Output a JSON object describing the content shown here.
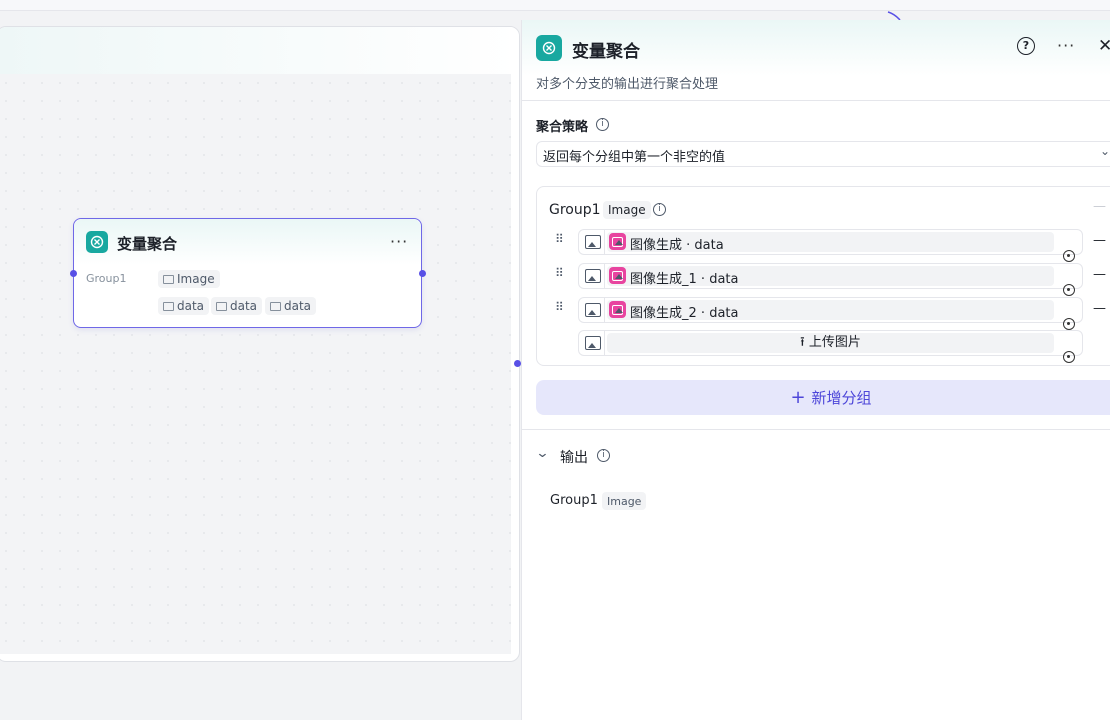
{
  "node": {
    "title": "变量聚合",
    "more": "···",
    "group_label": "Group1",
    "type_tag": "Image",
    "vars": [
      "data",
      "data",
      "data"
    ]
  },
  "panel": {
    "title": "变量聚合",
    "description": "对多个分支的输出进行聚合处理",
    "help": "?",
    "more": "···",
    "close": "✕",
    "strategy_label": "聚合策略",
    "strategy_value": "返回每个分组中第一个非空的值",
    "group": {
      "name": "Group1",
      "type": "Image",
      "minus": "—",
      "rows": [
        {
          "source": "图像生成",
          "sep": " · ",
          "var": "data"
        },
        {
          "source": "图像生成_1",
          "sep": " · ",
          "var": "data"
        },
        {
          "source": "图像生成_2",
          "sep": " · ",
          "var": "data"
        }
      ],
      "upload_label": "上传图片"
    },
    "add_group_label": "新增分组",
    "output_label": "输出",
    "output_group": "Group1",
    "output_type": "Image"
  },
  "colors": {
    "accent": "#5850e6",
    "teal": "#18a8a0",
    "pink": "#e8449f"
  },
  "icons": [
    "variable-aggregator-icon",
    "more-icon",
    "help-icon",
    "close-icon",
    "info-icon",
    "image-icon",
    "drag-handle-icon",
    "target-icon",
    "upload-icon",
    "plus-icon",
    "chevron-down-icon"
  ]
}
